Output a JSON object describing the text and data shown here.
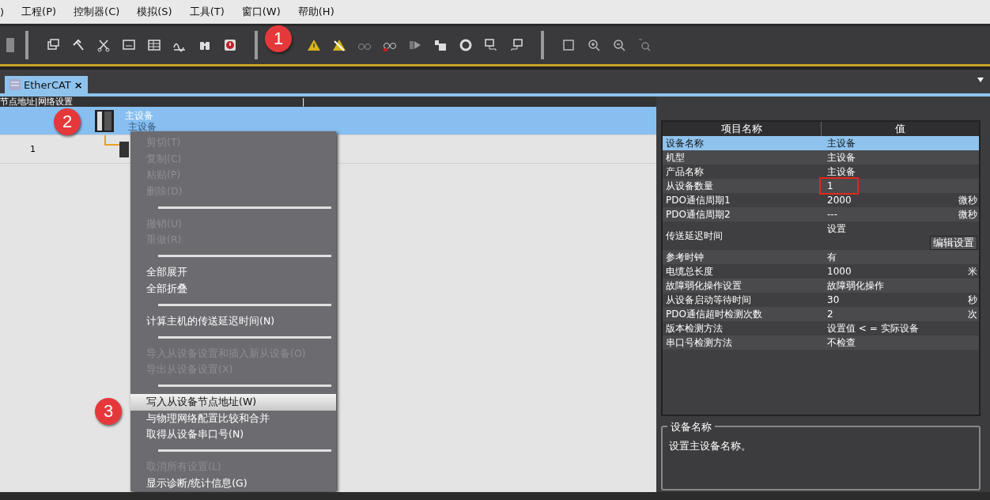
{
  "menu_bar": [
    ")",
    "工程(P)",
    "控制器(C)",
    "模拟(S)",
    "工具(T)",
    "窗口(W)",
    "帮助(H)"
  ],
  "callouts": [
    {
      "kind": "toolbar",
      "label": "1"
    },
    {
      "kind": "tree",
      "label": "2"
    },
    {
      "kind": "menu",
      "label": "3"
    }
  ],
  "tabs": [
    {
      "label": "EtherCAT",
      "close": "×",
      "selected": true
    }
  ],
  "tree": {
    "header": "节点地址|网络设置",
    "column_marker": "|",
    "master": {
      "name": "主设备",
      "model": "主设备",
      "selected": true
    },
    "slaves": [
      {
        "address": "1"
      }
    ]
  },
  "context_menu": [
    {
      "kind": "item",
      "label": "剪切(T)",
      "disabled": true,
      "selected": false
    },
    {
      "kind": "item",
      "label": "复制(C)",
      "disabled": true,
      "selected": false
    },
    {
      "kind": "item",
      "label": "粘贴(P)",
      "disabled": true,
      "selected": false
    },
    {
      "kind": "item",
      "label": "删除(D)",
      "disabled": true,
      "selected": false
    },
    {
      "kind": "separator"
    },
    {
      "kind": "item",
      "label": "撤销(U)",
      "disabled": true,
      "selected": false
    },
    {
      "kind": "item",
      "label": "重做(R)",
      "disabled": true,
      "selected": false
    },
    {
      "kind": "separator"
    },
    {
      "kind": "item",
      "label": "全部展开",
      "disabled": false,
      "selected": false
    },
    {
      "kind": "item",
      "label": "全部折叠",
      "disabled": false,
      "selected": false
    },
    {
      "kind": "separator"
    },
    {
      "kind": "item",
      "label": "计算主机的传送延迟时间(N)",
      "disabled": false,
      "selected": false
    },
    {
      "kind": "separator"
    },
    {
      "kind": "item",
      "label": "导入从设备设置和插入新从设备(O)",
      "disabled": true,
      "selected": false
    },
    {
      "kind": "item",
      "label": "导出从设备设置(X)",
      "disabled": true,
      "selected": false
    },
    {
      "kind": "separator"
    },
    {
      "kind": "item",
      "label": "写入从设备节点地址(W)",
      "disabled": false,
      "selected": true
    },
    {
      "kind": "item",
      "label": "与物理网络配置比较和合并",
      "disabled": false,
      "selected": false
    },
    {
      "kind": "item",
      "label": "取得从设备串口号(N)",
      "disabled": false,
      "selected": false
    },
    {
      "kind": "separator"
    },
    {
      "kind": "item",
      "label": "取消所有设置(L)",
      "disabled": true,
      "selected": false
    },
    {
      "kind": "item",
      "label": "显示诊断/统计信息(G)",
      "disabled": false,
      "selected": false
    }
  ],
  "properties": {
    "columns": [
      "项目名称",
      "值"
    ],
    "rows": [
      {
        "kind": "text",
        "name": "设备名称",
        "value": "主设备",
        "selected": true,
        "highlighted": false
      },
      {
        "kind": "text",
        "name": "机型",
        "value": "主设备",
        "selected": false,
        "highlighted": false
      },
      {
        "kind": "text",
        "name": "产品名称",
        "value": "主设备",
        "selected": false,
        "highlighted": false
      },
      {
        "kind": "text",
        "name": "从设备数量",
        "value": "1",
        "selected": false,
        "highlighted": true
      },
      {
        "kind": "text",
        "name": "PDO通信周期1",
        "value": "2000",
        "unit": "微秒",
        "selected": false,
        "highlighted": false
      },
      {
        "kind": "text",
        "name": "PDO通信周期2",
        "value": "---",
        "unit": "微秒",
        "selected": false,
        "highlighted": false
      },
      {
        "kind": "button",
        "name": "传送延迟时间",
        "value": "设置",
        "button": "编辑设置",
        "selected": false,
        "highlighted": false
      },
      {
        "kind": "text",
        "name": "参考时钟",
        "value": "有",
        "selected": false,
        "highlighted": false
      },
      {
        "kind": "text",
        "name": "电缆总长度",
        "value": "1000",
        "unit": "米",
        "selected": false,
        "highlighted": false
      },
      {
        "kind": "text",
        "name": "故障弱化操作设置",
        "value": "故障弱化操作",
        "selected": false,
        "highlighted": false
      },
      {
        "kind": "text",
        "name": "从设备启动等待时间",
        "value": "30",
        "unit": "秒",
        "selected": false,
        "highlighted": false
      },
      {
        "kind": "text",
        "name": "PDO通信超时检测次数",
        "value": "2",
        "unit": "次",
        "selected": false,
        "highlighted": false
      },
      {
        "kind": "text",
        "name": "版本检测方法",
        "value": "设置值 < = 实际设备",
        "selected": false,
        "highlighted": false
      },
      {
        "kind": "text",
        "name": "串口号检测方法",
        "value": "不检查",
        "selected": false,
        "highlighted": false
      }
    ]
  },
  "description": {
    "title": "设备名称",
    "text": "设置主设备名称。"
  }
}
